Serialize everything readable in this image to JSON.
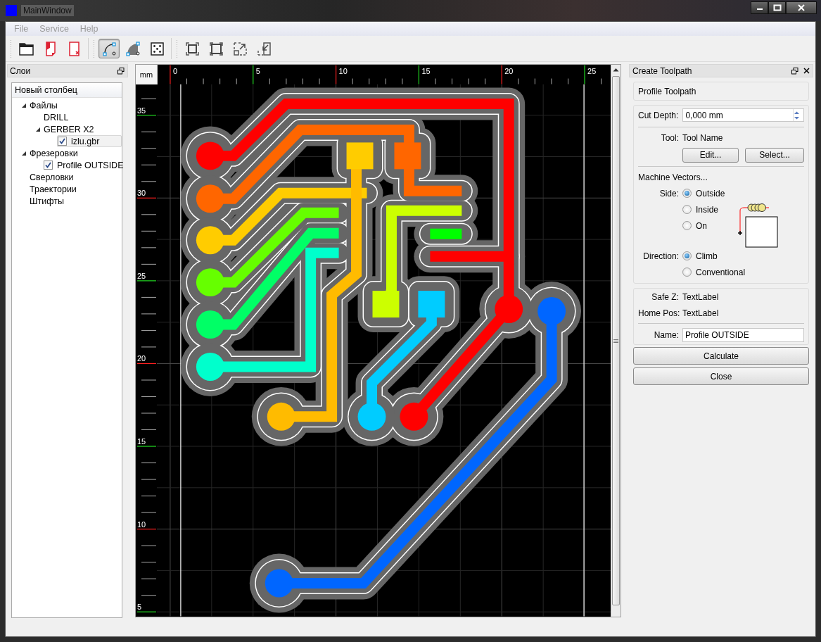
{
  "window": {
    "title": "MainWindow"
  },
  "menu": [
    "File",
    "Service",
    "Help"
  ],
  "toolbar": [
    [
      {
        "kind": "open-folder",
        "on": false
      },
      {
        "kind": "red-page",
        "on": false
      },
      {
        "kind": "delete-page",
        "on": false
      }
    ],
    [
      {
        "kind": "profile",
        "on": true
      },
      {
        "kind": "pocket",
        "on": false
      },
      {
        "kind": "drill",
        "on": false
      }
    ],
    [
      {
        "kind": "zoom-fit",
        "on": false
      },
      {
        "kind": "zoom-frame",
        "on": false
      },
      {
        "kind": "zoom-in",
        "on": false
      },
      {
        "kind": "zoom-out",
        "on": false
      }
    ]
  ],
  "layers": {
    "title": "Слои",
    "column": "Новый столбец",
    "tree": [
      {
        "label": "Файлы",
        "expanded": true,
        "selected": false,
        "children": [
          {
            "label": "DRILL",
            "selected": false
          },
          {
            "label": "GERBER X2",
            "expanded": true,
            "selected": false,
            "children": [
              {
                "label": "izlu.gbr",
                "checked": true,
                "selected": true
              }
            ]
          }
        ]
      },
      {
        "label": "Фрезеровки",
        "expanded": true,
        "selected": false,
        "children": [
          {
            "label": "Profile OUTSIDE",
            "checked": true,
            "selected": false
          }
        ]
      },
      {
        "label": "Сверловки",
        "selected": false
      },
      {
        "label": "Траектории",
        "selected": false
      },
      {
        "label": "Штифты",
        "selected": false
      }
    ]
  },
  "canvas": {
    "unit": "mm",
    "x_labels": [
      "0",
      "5",
      "10",
      "15",
      "20",
      "25"
    ],
    "y_labels": [
      "35",
      "30",
      "25",
      "20",
      "15",
      "10",
      "5"
    ]
  },
  "toolpath": {
    "title": "Create Toolpath",
    "heading": "Profile Toolpath",
    "cut_depth_label": "Cut Depth:",
    "cut_depth_value": "0,000 mm",
    "tool_label": "Tool:",
    "tool_value": "Tool Name",
    "tool_buttons": [
      "Edit...",
      "Select..."
    ],
    "vectors_label": "Machine Vectors...",
    "side_label": "Side:",
    "side_options": [
      {
        "label": "Outside",
        "selected": true
      },
      {
        "label": "Inside",
        "selected": false
      },
      {
        "label": "On",
        "selected": false
      }
    ],
    "direction_label": "Direction:",
    "direction_options": [
      {
        "label": "Climb",
        "selected": true
      },
      {
        "label": "Conventional",
        "selected": false
      }
    ],
    "safe_z_label": "Safe Z:",
    "safe_z_value": "TextLabel",
    "home_label": "Home Pos:",
    "home_value": "TextLabel",
    "name_label": "Name:",
    "name_value": "Profile OUTSIDE",
    "actions": [
      "Calculate",
      "Close"
    ]
  }
}
